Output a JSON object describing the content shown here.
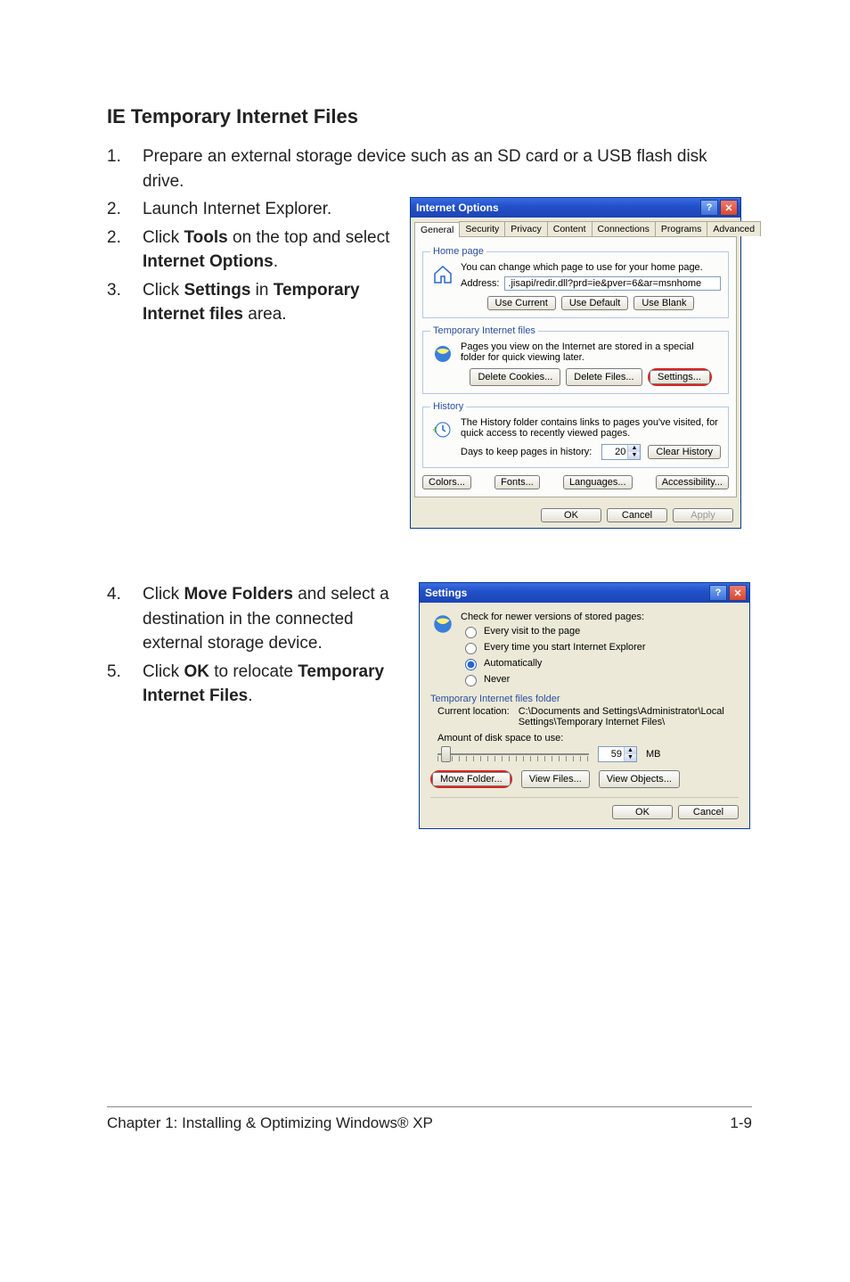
{
  "doc": {
    "heading": "IE Temporary Internet Files",
    "stepsA": [
      {
        "n": "1.",
        "t": "Prepare an external storage device such as an SD card or a USB flash disk drive."
      },
      {
        "n": "2.",
        "t": "Launch Internet Explorer."
      },
      {
        "n": "2.",
        "parts": [
          "Click ",
          "Tools",
          " on the top and select ",
          "Internet Options",
          "."
        ]
      },
      {
        "n": "3.",
        "parts": [
          "Click ",
          "Settings",
          " in ",
          "Temporary Internet files",
          " area."
        ]
      }
    ],
    "stepsB": [
      {
        "n": "4.",
        "parts": [
          "Click ",
          "Move Folders",
          " and select a destination in the connected external storage device."
        ]
      },
      {
        "n": "5.",
        "parts": [
          "Click ",
          "OK",
          " to relocate ",
          "Temporary Internet Files",
          "."
        ]
      }
    ],
    "footer_left": "Chapter 1:   Installing & Optimizing Windows® XP",
    "footer_right": "1-9"
  },
  "io_dialog": {
    "title": "Internet Options",
    "tabs": [
      "General",
      "Security",
      "Privacy",
      "Content",
      "Connections",
      "Programs",
      "Advanced"
    ],
    "home": {
      "legend": "Home page",
      "desc": "You can change which page to use for your home page.",
      "addr_label": "Address:",
      "addr_value": ".jisapi/redir.dll?prd=ie&pver=6&ar=msnhome",
      "buttons": {
        "current": "Use Current",
        "default": "Use Default",
        "blank": "Use Blank"
      }
    },
    "temp": {
      "legend": "Temporary Internet files",
      "desc": "Pages you view on the Internet are stored in a special folder for quick viewing later.",
      "buttons": {
        "cookies": "Delete Cookies...",
        "files": "Delete Files...",
        "settings": "Settings..."
      }
    },
    "history": {
      "legend": "History",
      "desc": "The History folder contains links to pages you've visited, for quick access to recently viewed pages.",
      "days_label": "Days to keep pages in history:",
      "days_value": "20",
      "clear": "Clear History"
    },
    "extras": {
      "colors": "Colors...",
      "fonts": "Fonts...",
      "langs": "Languages...",
      "access": "Accessibility..."
    },
    "dlg": {
      "ok": "OK",
      "cancel": "Cancel",
      "apply": "Apply"
    }
  },
  "settings_dialog": {
    "title": "Settings",
    "check_label": "Check for newer versions of stored pages:",
    "radios": {
      "every_visit": "Every visit to the page",
      "every_start": "Every time you start Internet Explorer",
      "auto": "Automatically",
      "never": "Never"
    },
    "selected_radio": "auto",
    "folder_section": "Temporary Internet files folder",
    "loc_label": "Current location:",
    "loc_value": "C:\\Documents and Settings\\Administrator\\Local Settings\\Temporary Internet Files\\",
    "space_label": "Amount of disk space to use:",
    "space_value": "59",
    "space_unit": "MB",
    "buttons": {
      "move": "Move Folder...",
      "viewf": "View Files...",
      "viewo": "View Objects..."
    },
    "dlg": {
      "ok": "OK",
      "cancel": "Cancel"
    }
  }
}
